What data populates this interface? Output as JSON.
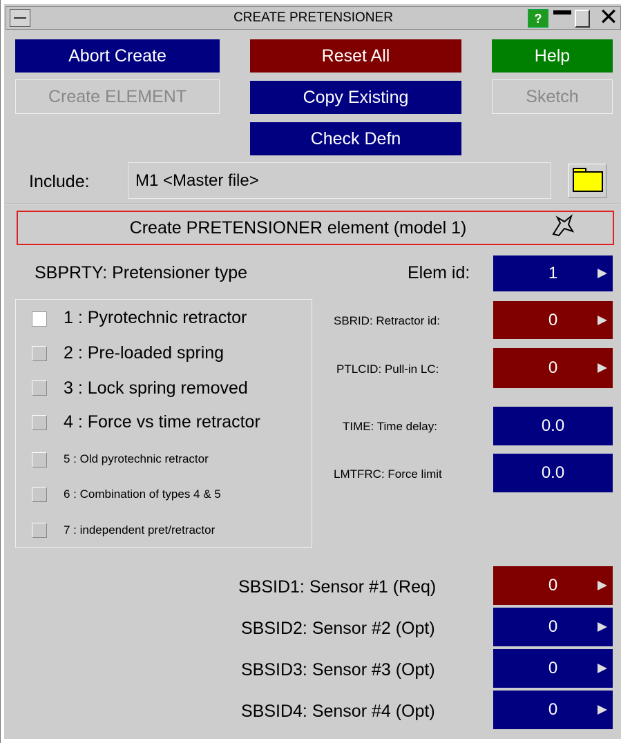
{
  "window": {
    "title": "CREATE PRETENSIONER",
    "help_label": "?"
  },
  "buttons": {
    "abort": "Abort Create",
    "reset": "Reset All",
    "help": "Help",
    "create_element": "Create ELEMENT",
    "copy_existing": "Copy Existing",
    "sketch": "Sketch",
    "check_defn": "Check Defn"
  },
  "include": {
    "label": "Include:",
    "value": "M1  <Master file>"
  },
  "header": {
    "text": "Create PRETENSIONER element (model 1)"
  },
  "sbprty": {
    "label": "SBPRTY: Pretensioner type",
    "options": [
      {
        "label": "1 : Pyrotechnic retractor",
        "checked": true
      },
      {
        "label": "2 : Pre-loaded spring",
        "checked": false
      },
      {
        "label": "3 : Lock spring removed",
        "checked": false
      },
      {
        "label": "4 : Force vs time retractor",
        "checked": false
      },
      {
        "label": "5 : Old pyrotechnic retractor",
        "checked": false
      },
      {
        "label": "6 : Combination of types 4 & 5",
        "checked": false
      },
      {
        "label": "7 : independent pret/retractor",
        "checked": false
      }
    ]
  },
  "fields": {
    "elem_id": {
      "label": "Elem id:",
      "value": "1"
    },
    "sbrid": {
      "label": "SBRID: Retractor id:",
      "value": "0"
    },
    "ptlcid": {
      "label": "PTLCID: Pull-in LC:",
      "value": "0"
    },
    "time": {
      "label": "TIME: Time delay:",
      "value": "0.0"
    },
    "lmtfrc": {
      "label": "LMTFRC: Force limit",
      "value": "0.0"
    }
  },
  "sensors": [
    {
      "label": "SBSID1: Sensor #1 (Req)",
      "value": "0"
    },
    {
      "label": "SBSID2: Sensor #2 (Opt)",
      "value": "0"
    },
    {
      "label": "SBSID3: Sensor #3 (Opt)",
      "value": "0"
    },
    {
      "label": "SBSID4: Sensor #4 (Opt)",
      "value": "0"
    }
  ],
  "colors": {
    "blue": "#000080",
    "red": "#800000",
    "green": "#008000",
    "panel": "#cdcdcd"
  }
}
